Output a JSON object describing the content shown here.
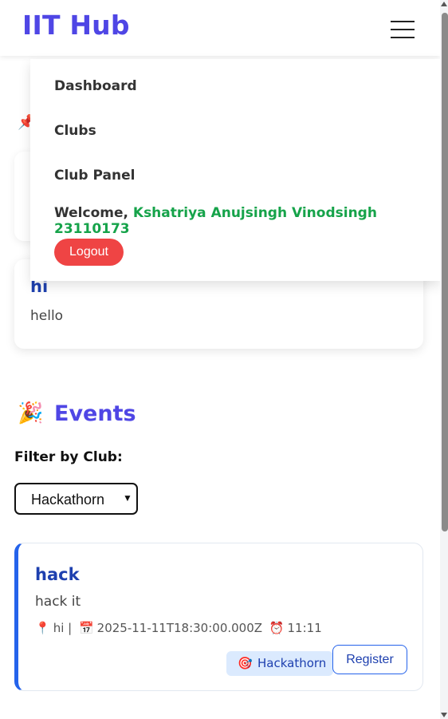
{
  "navbar": {
    "brand": "IIT Hub",
    "menu_icon": "hamburger-menu-icon"
  },
  "menu": {
    "items": [
      {
        "label": "Dashboard"
      },
      {
        "label": "Clubs"
      },
      {
        "label": "Club Panel"
      }
    ],
    "welcome_prefix": "Welcome, ",
    "user_name": "Kshatriya Anujsingh Vinodsingh 23110173",
    "logout_label": "Logout"
  },
  "announcement": {
    "pin_icon": "📌",
    "title": "hi",
    "body": "hello"
  },
  "events": {
    "emoji": "🎉",
    "heading": "Events",
    "filter_label": "Filter by Club:",
    "selected_club": "Hackathorn",
    "list": [
      {
        "title": "hack",
        "description": "hack it",
        "location_icon": "📍",
        "location": "hi |",
        "date_icon": "📅",
        "date": "2025-11-11T18:30:00.000Z",
        "time_icon": "⏰",
        "time": "11:11",
        "club_icon": "🎯",
        "club": "Hackathorn",
        "register_label": "Register"
      }
    ]
  },
  "colors": {
    "brand": "#4f46e5",
    "welcome_name": "#16a34a",
    "logout": "#ef4444",
    "title_blue": "#1e40af",
    "accent": "#2563eb"
  }
}
